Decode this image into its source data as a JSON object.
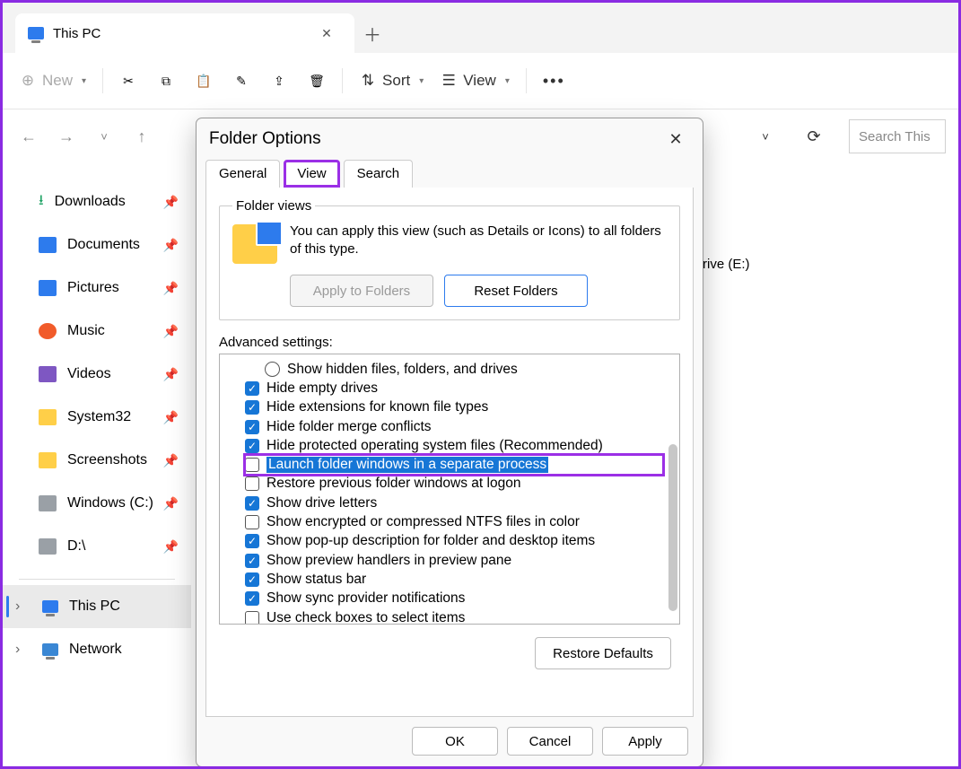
{
  "tab": {
    "title": "This PC"
  },
  "toolbar": {
    "new": "New",
    "sort": "Sort",
    "view": "View"
  },
  "search": {
    "placeholder": "Search This"
  },
  "sidebar": {
    "pinned": [
      {
        "label": "Downloads"
      },
      {
        "label": "Documents"
      },
      {
        "label": "Pictures"
      },
      {
        "label": "Music"
      },
      {
        "label": "Videos"
      },
      {
        "label": "System32"
      },
      {
        "label": "Screenshots"
      },
      {
        "label": "Windows (C:)"
      },
      {
        "label": "D:\\"
      }
    ],
    "tree": [
      {
        "label": "This PC"
      },
      {
        "label": "Network"
      }
    ]
  },
  "rpane": {
    "drive": "rive (E:)"
  },
  "dialog": {
    "title": "Folder Options",
    "tabs": {
      "general": "General",
      "view": "View",
      "search": "Search"
    },
    "folder_views": {
      "legend": "Folder views",
      "text": "You can apply this view (such as Details or Icons) to all folders of this type.",
      "apply": "Apply to Folders",
      "reset": "Reset Folders"
    },
    "adv_label": "Advanced settings:",
    "options": [
      {
        "type": "radio",
        "checked": false,
        "indent": true,
        "label": "Show hidden files, folders, and drives"
      },
      {
        "type": "checkbox",
        "checked": true,
        "indent": false,
        "label": "Hide empty drives"
      },
      {
        "type": "checkbox",
        "checked": true,
        "indent": false,
        "label": "Hide extensions for known file types"
      },
      {
        "type": "checkbox",
        "checked": true,
        "indent": false,
        "label": "Hide folder merge conflicts"
      },
      {
        "type": "checkbox",
        "checked": true,
        "indent": false,
        "label": "Hide protected operating system files (Recommended)"
      },
      {
        "type": "checkbox",
        "checked": false,
        "indent": false,
        "label": "Launch folder windows in a separate process",
        "selected": true
      },
      {
        "type": "checkbox",
        "checked": false,
        "indent": false,
        "label": "Restore previous folder windows at logon"
      },
      {
        "type": "checkbox",
        "checked": true,
        "indent": false,
        "label": "Show drive letters"
      },
      {
        "type": "checkbox",
        "checked": false,
        "indent": false,
        "label": "Show encrypted or compressed NTFS files in color"
      },
      {
        "type": "checkbox",
        "checked": true,
        "indent": false,
        "label": "Show pop-up description for folder and desktop items"
      },
      {
        "type": "checkbox",
        "checked": true,
        "indent": false,
        "label": "Show preview handlers in preview pane"
      },
      {
        "type": "checkbox",
        "checked": true,
        "indent": false,
        "label": "Show status bar"
      },
      {
        "type": "checkbox",
        "checked": true,
        "indent": false,
        "label": "Show sync provider notifications"
      },
      {
        "type": "checkbox",
        "checked": false,
        "indent": false,
        "label": "Use check boxes to select items"
      }
    ],
    "restore": "Restore Defaults",
    "footer": {
      "ok": "OK",
      "cancel": "Cancel",
      "apply": "Apply"
    }
  }
}
